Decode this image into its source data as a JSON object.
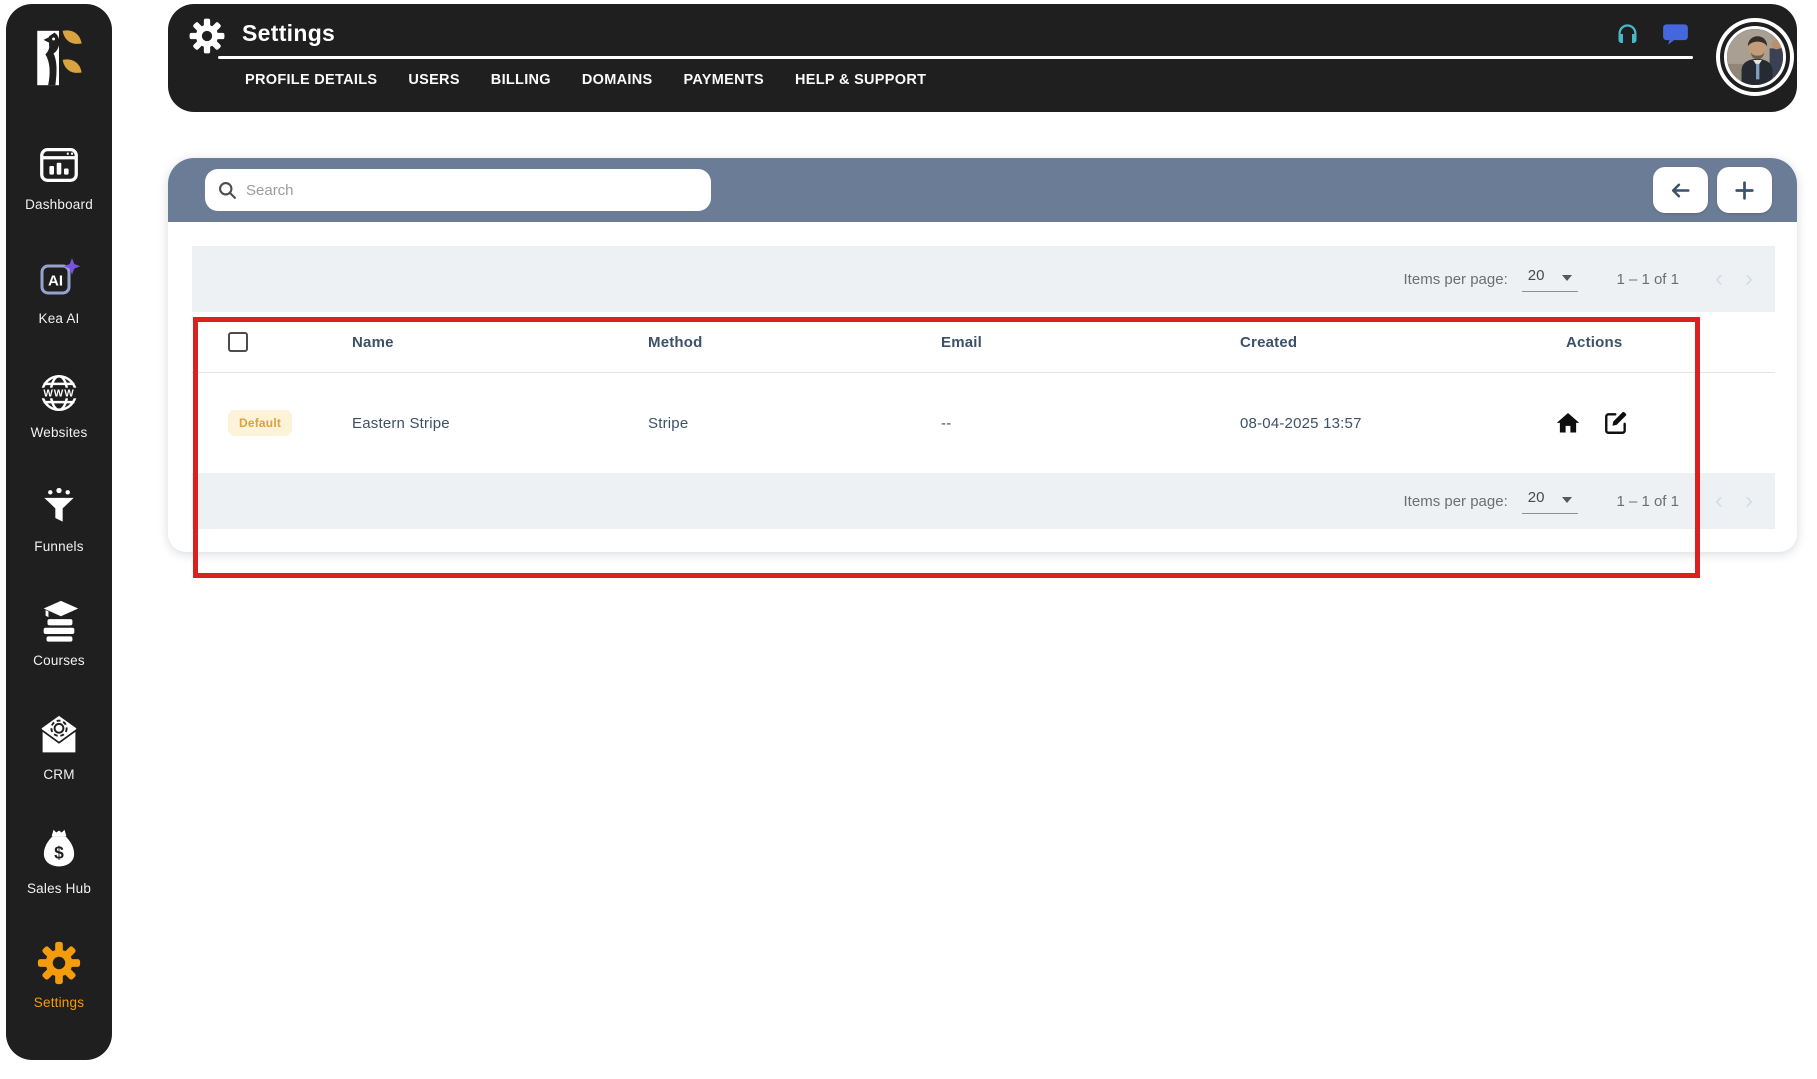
{
  "sidebar": {
    "items": [
      {
        "label": "Dashboard"
      },
      {
        "label": "Kea AI"
      },
      {
        "label": "Websites"
      },
      {
        "label": "Funnels"
      },
      {
        "label": "Courses"
      },
      {
        "label": "CRM"
      },
      {
        "label": "Sales Hub"
      },
      {
        "label": "Settings"
      }
    ],
    "active_item": "Settings"
  },
  "header": {
    "title": "Settings",
    "tabs": [
      {
        "label": "PROFILE DETAILS"
      },
      {
        "label": "USERS"
      },
      {
        "label": "BILLING"
      },
      {
        "label": "DOMAINS"
      },
      {
        "label": "PAYMENTS"
      },
      {
        "label": "HELP & SUPPORT"
      }
    ]
  },
  "toolbar": {
    "search_placeholder": "Search"
  },
  "paginator": {
    "items_per_page_label": "Items per page:",
    "page_size": "20",
    "range_label": "1 – 1 of 1"
  },
  "table": {
    "columns": {
      "name": "Name",
      "method": "Method",
      "email": "Email",
      "created": "Created",
      "actions": "Actions"
    },
    "rows": [
      {
        "badge": "Default",
        "name": "Eastern Stripe",
        "method": "Stripe",
        "email": "--",
        "created": "08-04-2025 13:57"
      }
    ]
  },
  "annotation": {
    "type": "highlight-box",
    "color": "#dc2020"
  },
  "colors": {
    "sidebar_bg": "#1f1f1f",
    "accent_orange": "#f59c0b",
    "toolbar_slate": "#6b7c96",
    "band_gray": "#edf1f4",
    "badge_bg": "#fcf3d9",
    "badge_text": "#dfa03d",
    "headset_icon": "#46b8c9",
    "chat_icon": "#4467e0",
    "logo_gold": "#d9a33f"
  }
}
